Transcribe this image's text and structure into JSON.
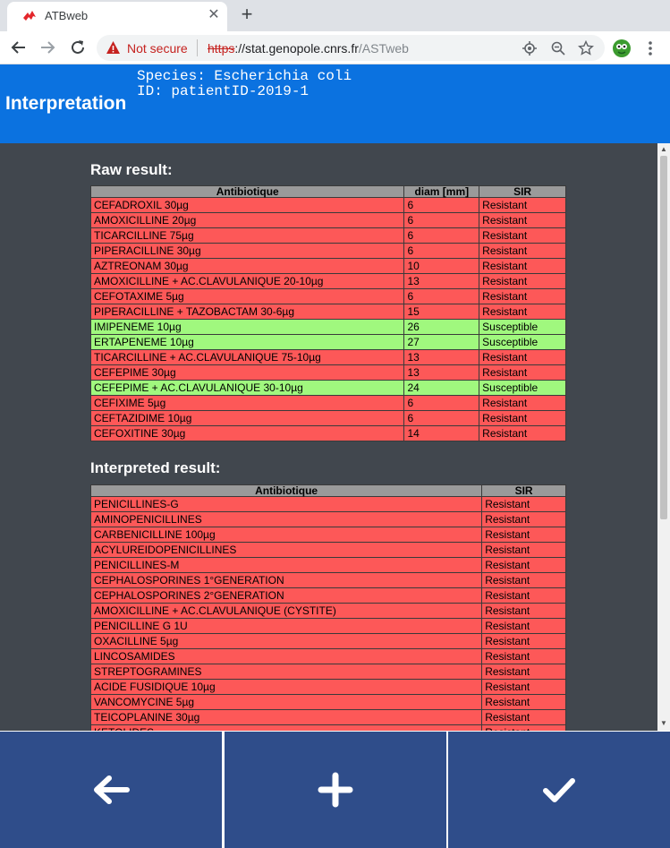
{
  "browser": {
    "tab_title": "ATBweb",
    "security_label": "Not secure",
    "url_scheme": "https",
    "url_host": "://stat.genopole.cnrs.fr",
    "url_path": "/ASTweb"
  },
  "header": {
    "title": "Interpretation",
    "species_line": "Species: Escherichia coli",
    "id_line": "ID: patientID-2019-1"
  },
  "raw": {
    "title": "Raw result:",
    "columns": [
      "Antibiotique",
      "diam [mm]",
      "SIR"
    ],
    "rows": [
      {
        "name": "CEFADROXIL 30µg",
        "diam": "6",
        "sir": "Resistant"
      },
      {
        "name": "AMOXICILLINE 20µg",
        "diam": "6",
        "sir": "Resistant"
      },
      {
        "name": "TICARCILLINE 75µg",
        "diam": "6",
        "sir": "Resistant"
      },
      {
        "name": "PIPERACILLINE 30µg",
        "diam": "6",
        "sir": "Resistant"
      },
      {
        "name": "AZTREONAM 30µg",
        "diam": "10",
        "sir": "Resistant"
      },
      {
        "name": "AMOXICILLINE + AC.CLAVULANIQUE 20-10µg",
        "diam": "13",
        "sir": "Resistant"
      },
      {
        "name": "CEFOTAXIME 5µg",
        "diam": "6",
        "sir": "Resistant"
      },
      {
        "name": "PIPERACILLINE + TAZOBACTAM 30-6µg",
        "diam": "15",
        "sir": "Resistant"
      },
      {
        "name": "IMIPENEME 10µg",
        "diam": "26",
        "sir": "Susceptible"
      },
      {
        "name": "ERTAPENEME 10µg",
        "diam": "27",
        "sir": "Susceptible"
      },
      {
        "name": "TICARCILLINE + AC.CLAVULANIQUE 75-10µg",
        "diam": "13",
        "sir": "Resistant"
      },
      {
        "name": "CEFEPIME 30µg",
        "diam": "13",
        "sir": "Resistant"
      },
      {
        "name": "CEFEPIME + AC.CLAVULANIQUE 30-10µg",
        "diam": "24",
        "sir": "Susceptible"
      },
      {
        "name": "CEFIXIME 5µg",
        "diam": "6",
        "sir": "Resistant"
      },
      {
        "name": "CEFTAZIDIME 10µg",
        "diam": "6",
        "sir": "Resistant"
      },
      {
        "name": "CEFOXITINE 30µg",
        "diam": "14",
        "sir": "Resistant"
      }
    ]
  },
  "interpreted": {
    "title": "Interpreted result:",
    "columns": [
      "Antibiotique",
      "SIR"
    ],
    "rows": [
      {
        "name": "PENICILLINES-G",
        "sir": "Resistant"
      },
      {
        "name": "AMINOPENICILLINES",
        "sir": "Resistant"
      },
      {
        "name": "CARBENICILLINE 100µg",
        "sir": "Resistant"
      },
      {
        "name": "ACYLUREIDOPENICILLINES",
        "sir": "Resistant"
      },
      {
        "name": "PENICILLINES-M",
        "sir": "Resistant"
      },
      {
        "name": "CEPHALOSPORINES 1°GENERATION",
        "sir": "Resistant"
      },
      {
        "name": "CEPHALOSPORINES 2°GENERATION",
        "sir": "Resistant"
      },
      {
        "name": "AMOXICILLINE + AC.CLAVULANIQUE (CYSTITE)",
        "sir": "Resistant"
      },
      {
        "name": "PENICILLINE G 1U",
        "sir": "Resistant"
      },
      {
        "name": "OXACILLINE 5µg",
        "sir": "Resistant"
      },
      {
        "name": "LINCOSAMIDES",
        "sir": "Resistant"
      },
      {
        "name": "STREPTOGRAMINES",
        "sir": "Resistant"
      },
      {
        "name": "ACIDE FUSIDIQUE 10µg",
        "sir": "Resistant"
      },
      {
        "name": "VANCOMYCINE 5µg",
        "sir": "Resistant"
      },
      {
        "name": "TEICOPLANINE 30µg",
        "sir": "Resistant"
      },
      {
        "name": "KETOLIDES",
        "sir": "Resistant"
      }
    ]
  },
  "colors": {
    "resistant": "#fd5858",
    "susceptible": "#a0f87e",
    "header_blue": "#0b72e0",
    "button_blue": "#2f4d8a"
  },
  "actions": {
    "back_icon": "arrow-left-icon",
    "add_icon": "plus-icon",
    "confirm_icon": "check-icon"
  }
}
